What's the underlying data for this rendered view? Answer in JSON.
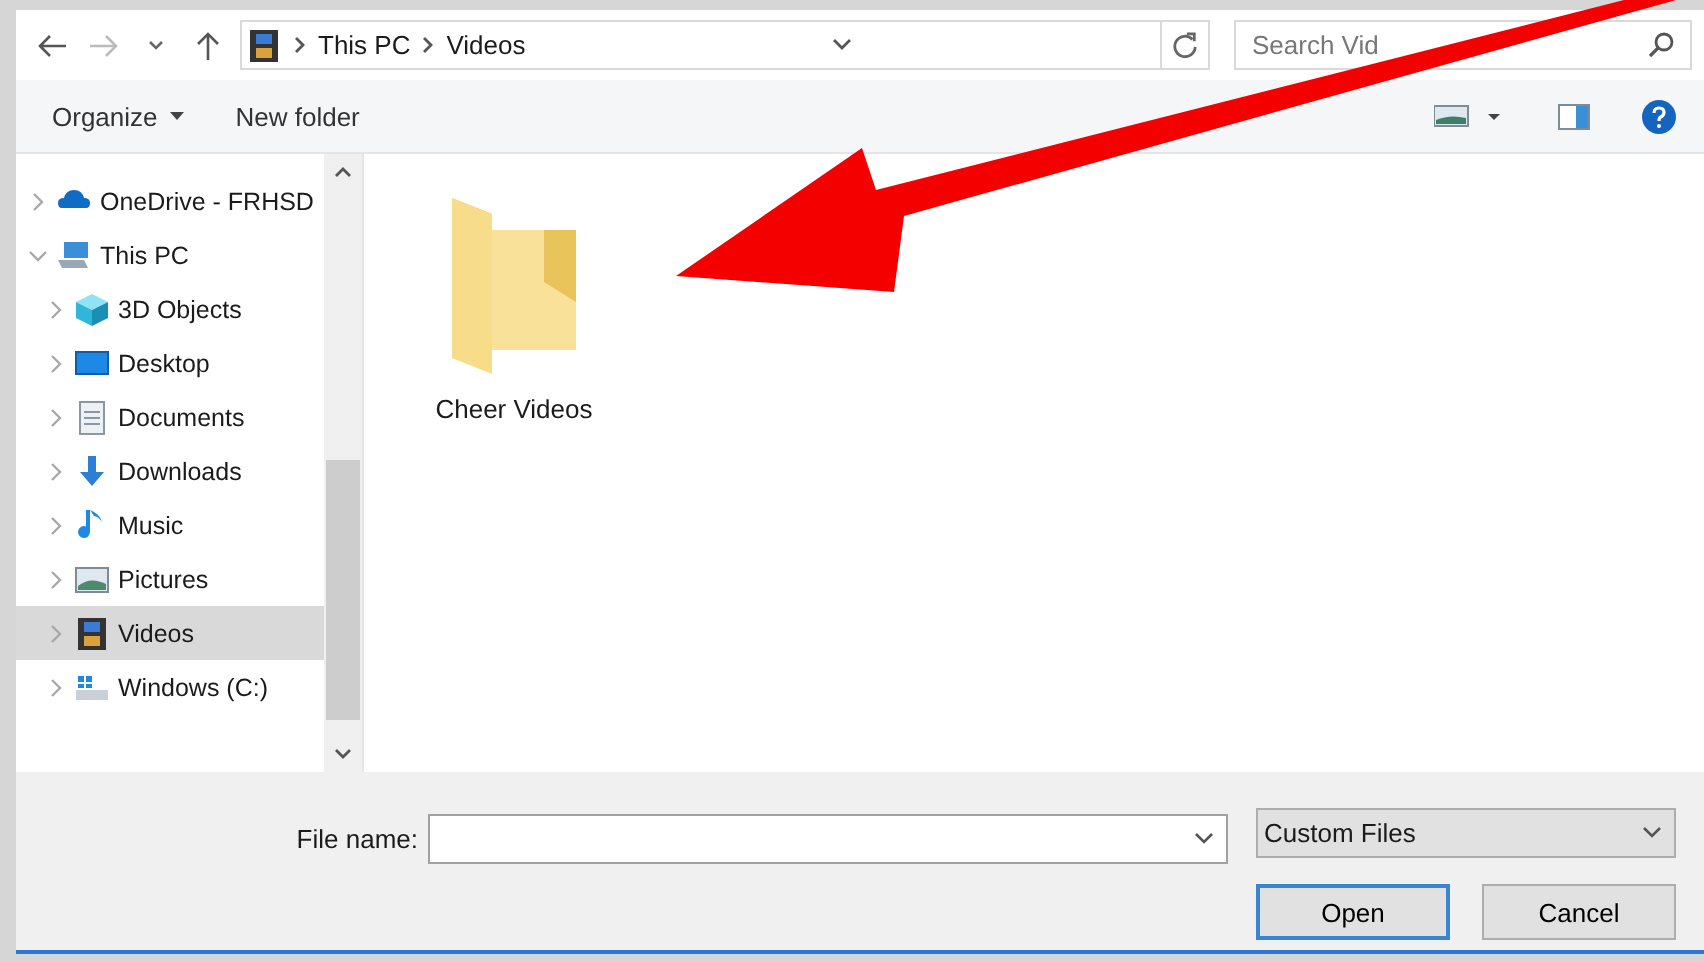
{
  "address_bar": {
    "path": [
      "This PC",
      "Videos"
    ]
  },
  "search": {
    "placeholder": "Search Vid"
  },
  "toolbar": {
    "buttons": [
      "Organize",
      "New folder"
    ]
  },
  "navigation_pane": {
    "items": [
      {
        "label": "OneDrive - FRHSD",
        "kind": "cloud",
        "expanded": false,
        "selected": false
      },
      {
        "label": "This PC",
        "kind": "computer",
        "expanded": true,
        "selected": false,
        "children": [
          {
            "label": "3D Objects",
            "kind": "cube",
            "expanded": false,
            "selected": false
          },
          {
            "label": "Desktop",
            "kind": "desktop",
            "expanded": false,
            "selected": false
          },
          {
            "label": "Documents",
            "kind": "document",
            "expanded": false,
            "selected": false
          },
          {
            "label": "Downloads",
            "kind": "download",
            "expanded": false,
            "selected": false
          },
          {
            "label": "Music",
            "kind": "music",
            "expanded": false,
            "selected": false
          },
          {
            "label": "Pictures",
            "kind": "pictures",
            "expanded": false,
            "selected": false
          },
          {
            "label": "Videos",
            "kind": "film",
            "expanded": false,
            "selected": true
          },
          {
            "label": "Windows (C:)",
            "kind": "drive",
            "expanded": false,
            "selected": false
          }
        ]
      }
    ]
  },
  "files": [
    {
      "name": "Cheer Videos",
      "kind": "folder"
    }
  ],
  "footer": {
    "file_name_label": "File name:",
    "file_type": "Custom Files",
    "buttons": [
      {
        "label": "Open",
        "default": true
      },
      {
        "label": "Cancel",
        "default": false
      }
    ]
  }
}
